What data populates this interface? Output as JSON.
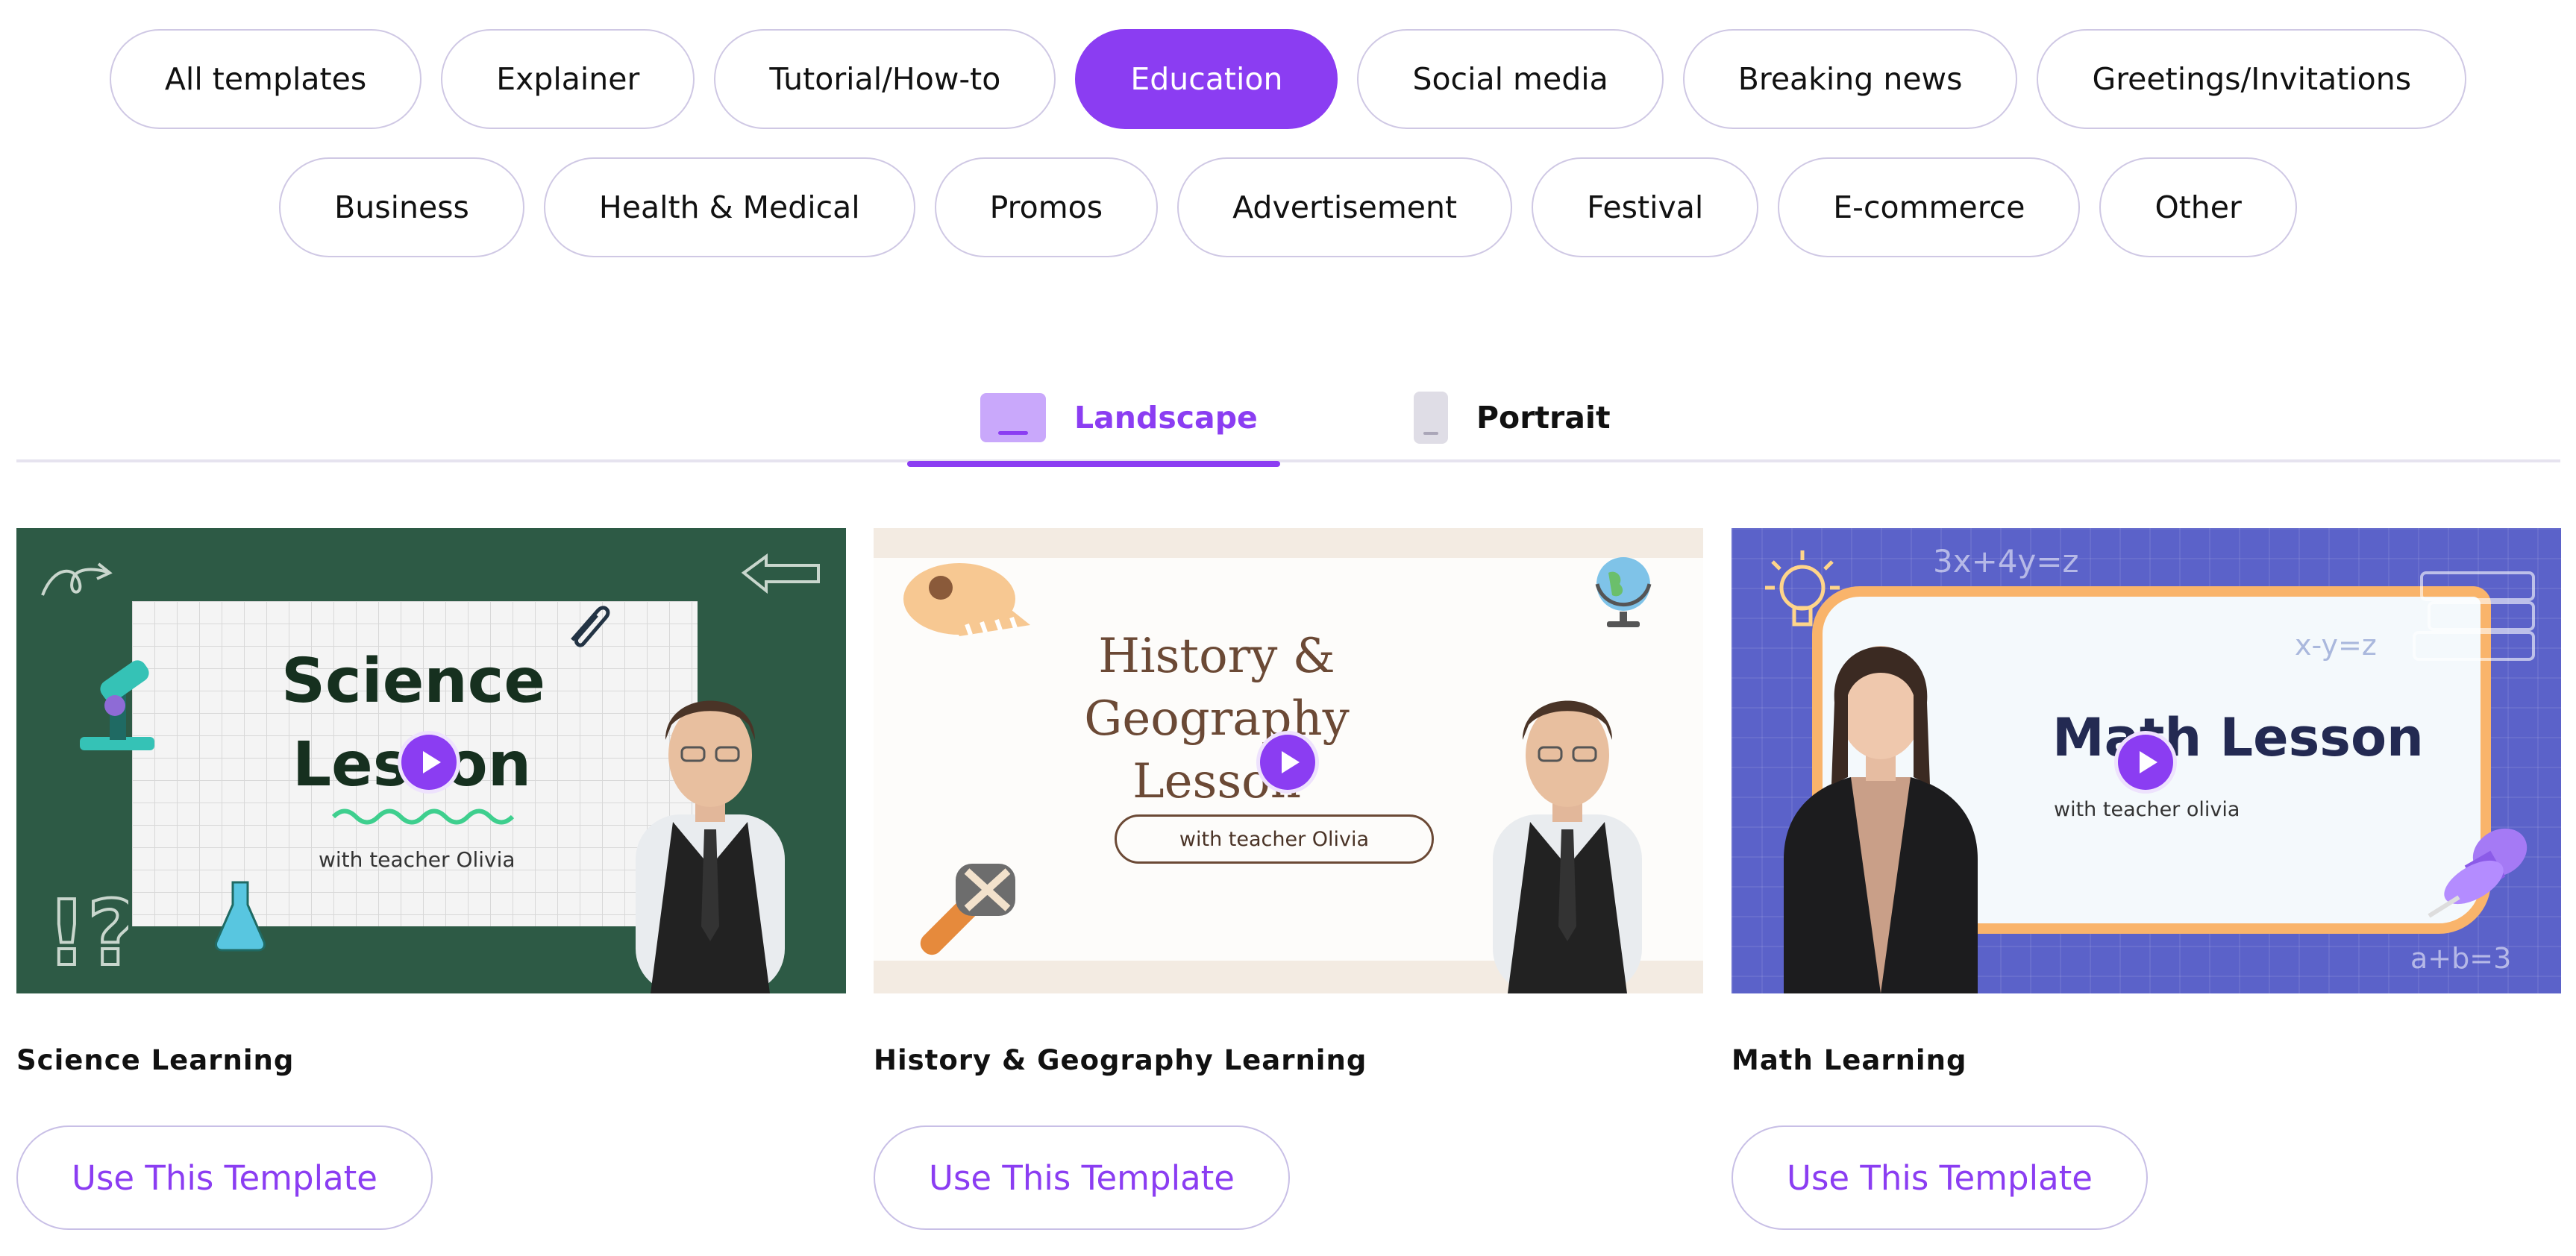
{
  "categories": {
    "row1": [
      "All templates",
      "Explainer",
      "Tutorial/How-to",
      "Education",
      "Social media",
      "Breaking news",
      "Greetings/Invitations"
    ],
    "row2": [
      "Business",
      "Health & Medical",
      "Promos",
      "Advertisement",
      "Festival",
      "E-commerce",
      "Other"
    ],
    "active": "Education"
  },
  "tabs": {
    "landscape": "Landscape",
    "portrait": "Portrait",
    "active": "Landscape"
  },
  "templates": [
    {
      "name": "Science Learning",
      "thumb_title_line1": "Science",
      "thumb_title_line2": "Lesson",
      "thumb_subtitle": "with teacher Olivia",
      "button": "Use This Template"
    },
    {
      "name": "History & Geography Learning",
      "thumb_title_line1": "History & Geography",
      "thumb_title_line2": "Lesson",
      "thumb_subtitle": "with teacher Olivia",
      "button": "Use This Template"
    },
    {
      "name": "Math Learning",
      "thumb_title": "Math Lesson",
      "thumb_subtitle": "with teacher olivia",
      "thumb_equations": [
        "3x+4y=z",
        "x-y=z",
        "a+b=3"
      ],
      "button": "Use This Template"
    }
  ],
  "colors": {
    "accent": "#8b3df2",
    "chip_border": "#cfc8e4",
    "science_bg": "#2d5a45",
    "history_bg": "#f3ebe2",
    "math_bg": "#5b62c9"
  }
}
